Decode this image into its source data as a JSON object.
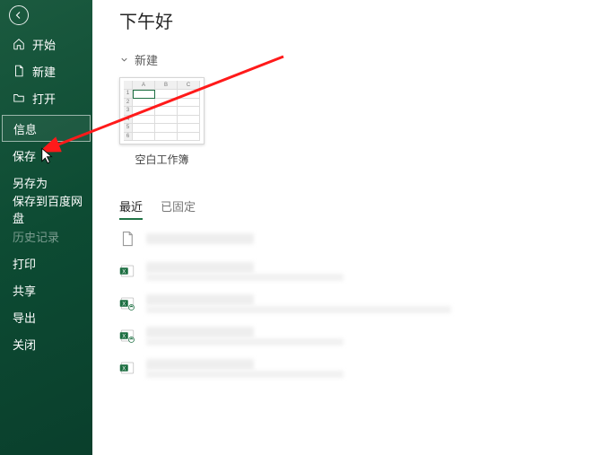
{
  "sidebar": {
    "items": [
      {
        "label": "开始",
        "icon": "home-icon"
      },
      {
        "label": "新建",
        "icon": "new-doc-icon"
      },
      {
        "label": "打开",
        "icon": "open-folder-icon"
      },
      {
        "label": "信息"
      },
      {
        "label": "保存"
      },
      {
        "label": "另存为"
      },
      {
        "label": "保存到百度网盘"
      },
      {
        "label": "历史记录"
      },
      {
        "label": "打印"
      },
      {
        "label": "共享"
      },
      {
        "label": "导出"
      },
      {
        "label": "关闭"
      }
    ]
  },
  "content": {
    "greeting": "下午好",
    "new_section_label": "新建",
    "templates": [
      {
        "label": "空白工作簿"
      }
    ],
    "tabs": {
      "recent": "最近",
      "pinned": "已固定"
    }
  }
}
